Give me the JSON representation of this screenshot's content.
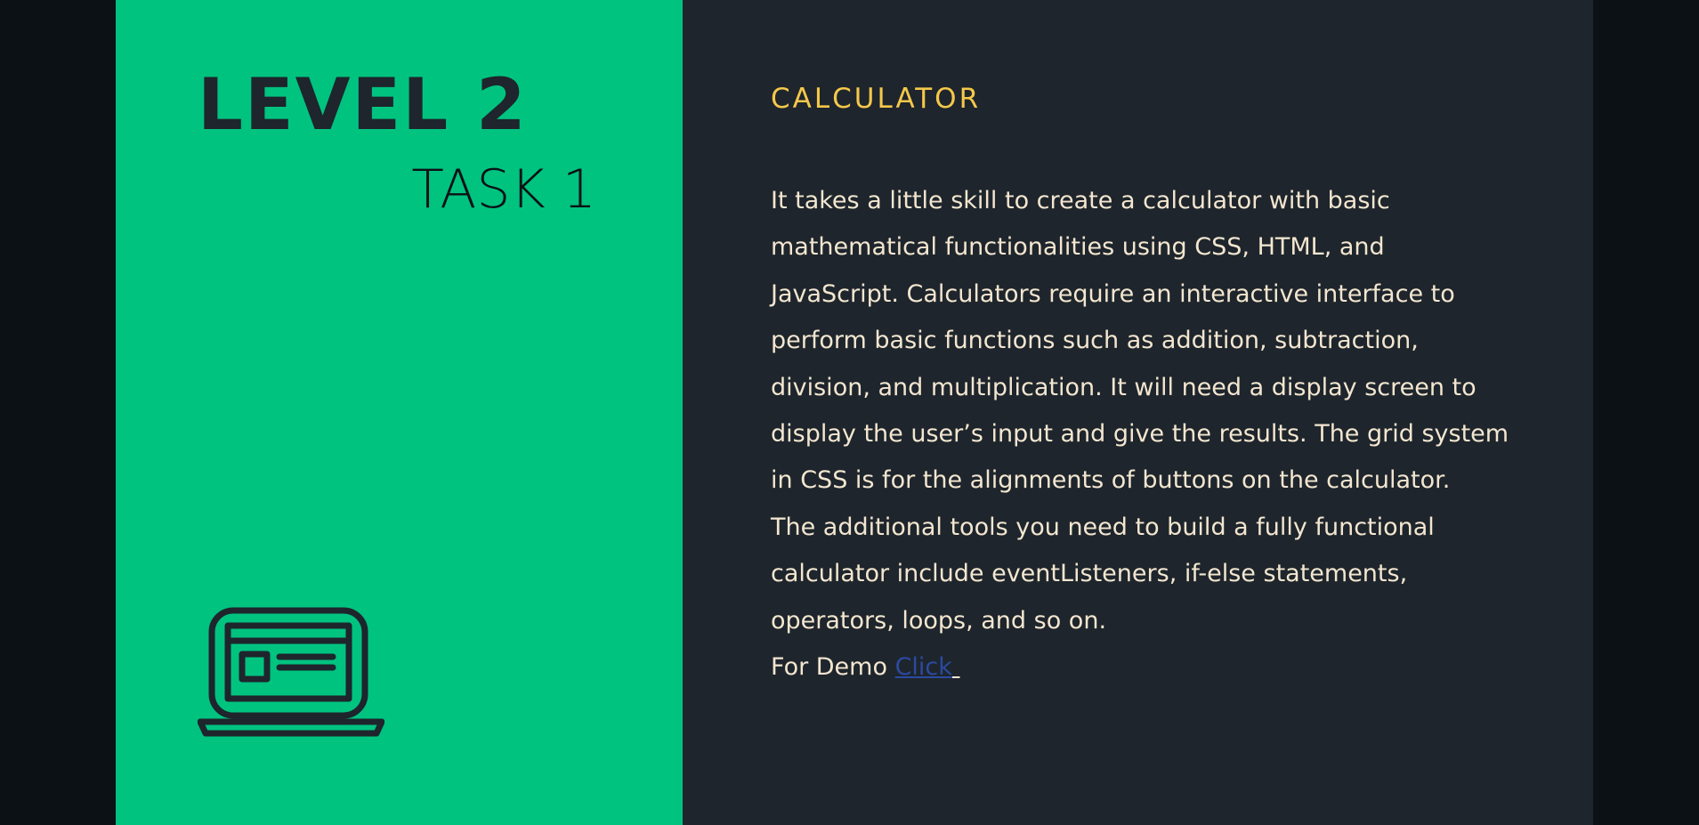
{
  "colors": {
    "accent_green": "#00c37f",
    "panel_dark": "#1e252c",
    "title_yellow": "#f5c84a",
    "link_blue": "#2b4aa0"
  },
  "left": {
    "level": "LEVEL 2",
    "task": "TASK 1",
    "icon": "laptop-icon"
  },
  "right": {
    "title": "CALCULATOR",
    "lines": [
      "It takes a little skill to create a calculator with basic",
      "mathematical functionalities using CSS, HTML, and",
      "JavaScript. Calculators require an interactive interface to",
      "perform basic functions such as addition, subtraction,",
      "division, and multiplication. It will need a  display screen to",
      "display the user’s input and give the results. The grid system",
      "in CSS is for the alignments of buttons on the calculator.",
      "The additional tools you need to build a fully functional",
      "calculator include eventListeners, if-else statements,",
      "operators, loops, and so on."
    ],
    "demo_prefix": "For Demo ",
    "demo_link": "Click"
  }
}
